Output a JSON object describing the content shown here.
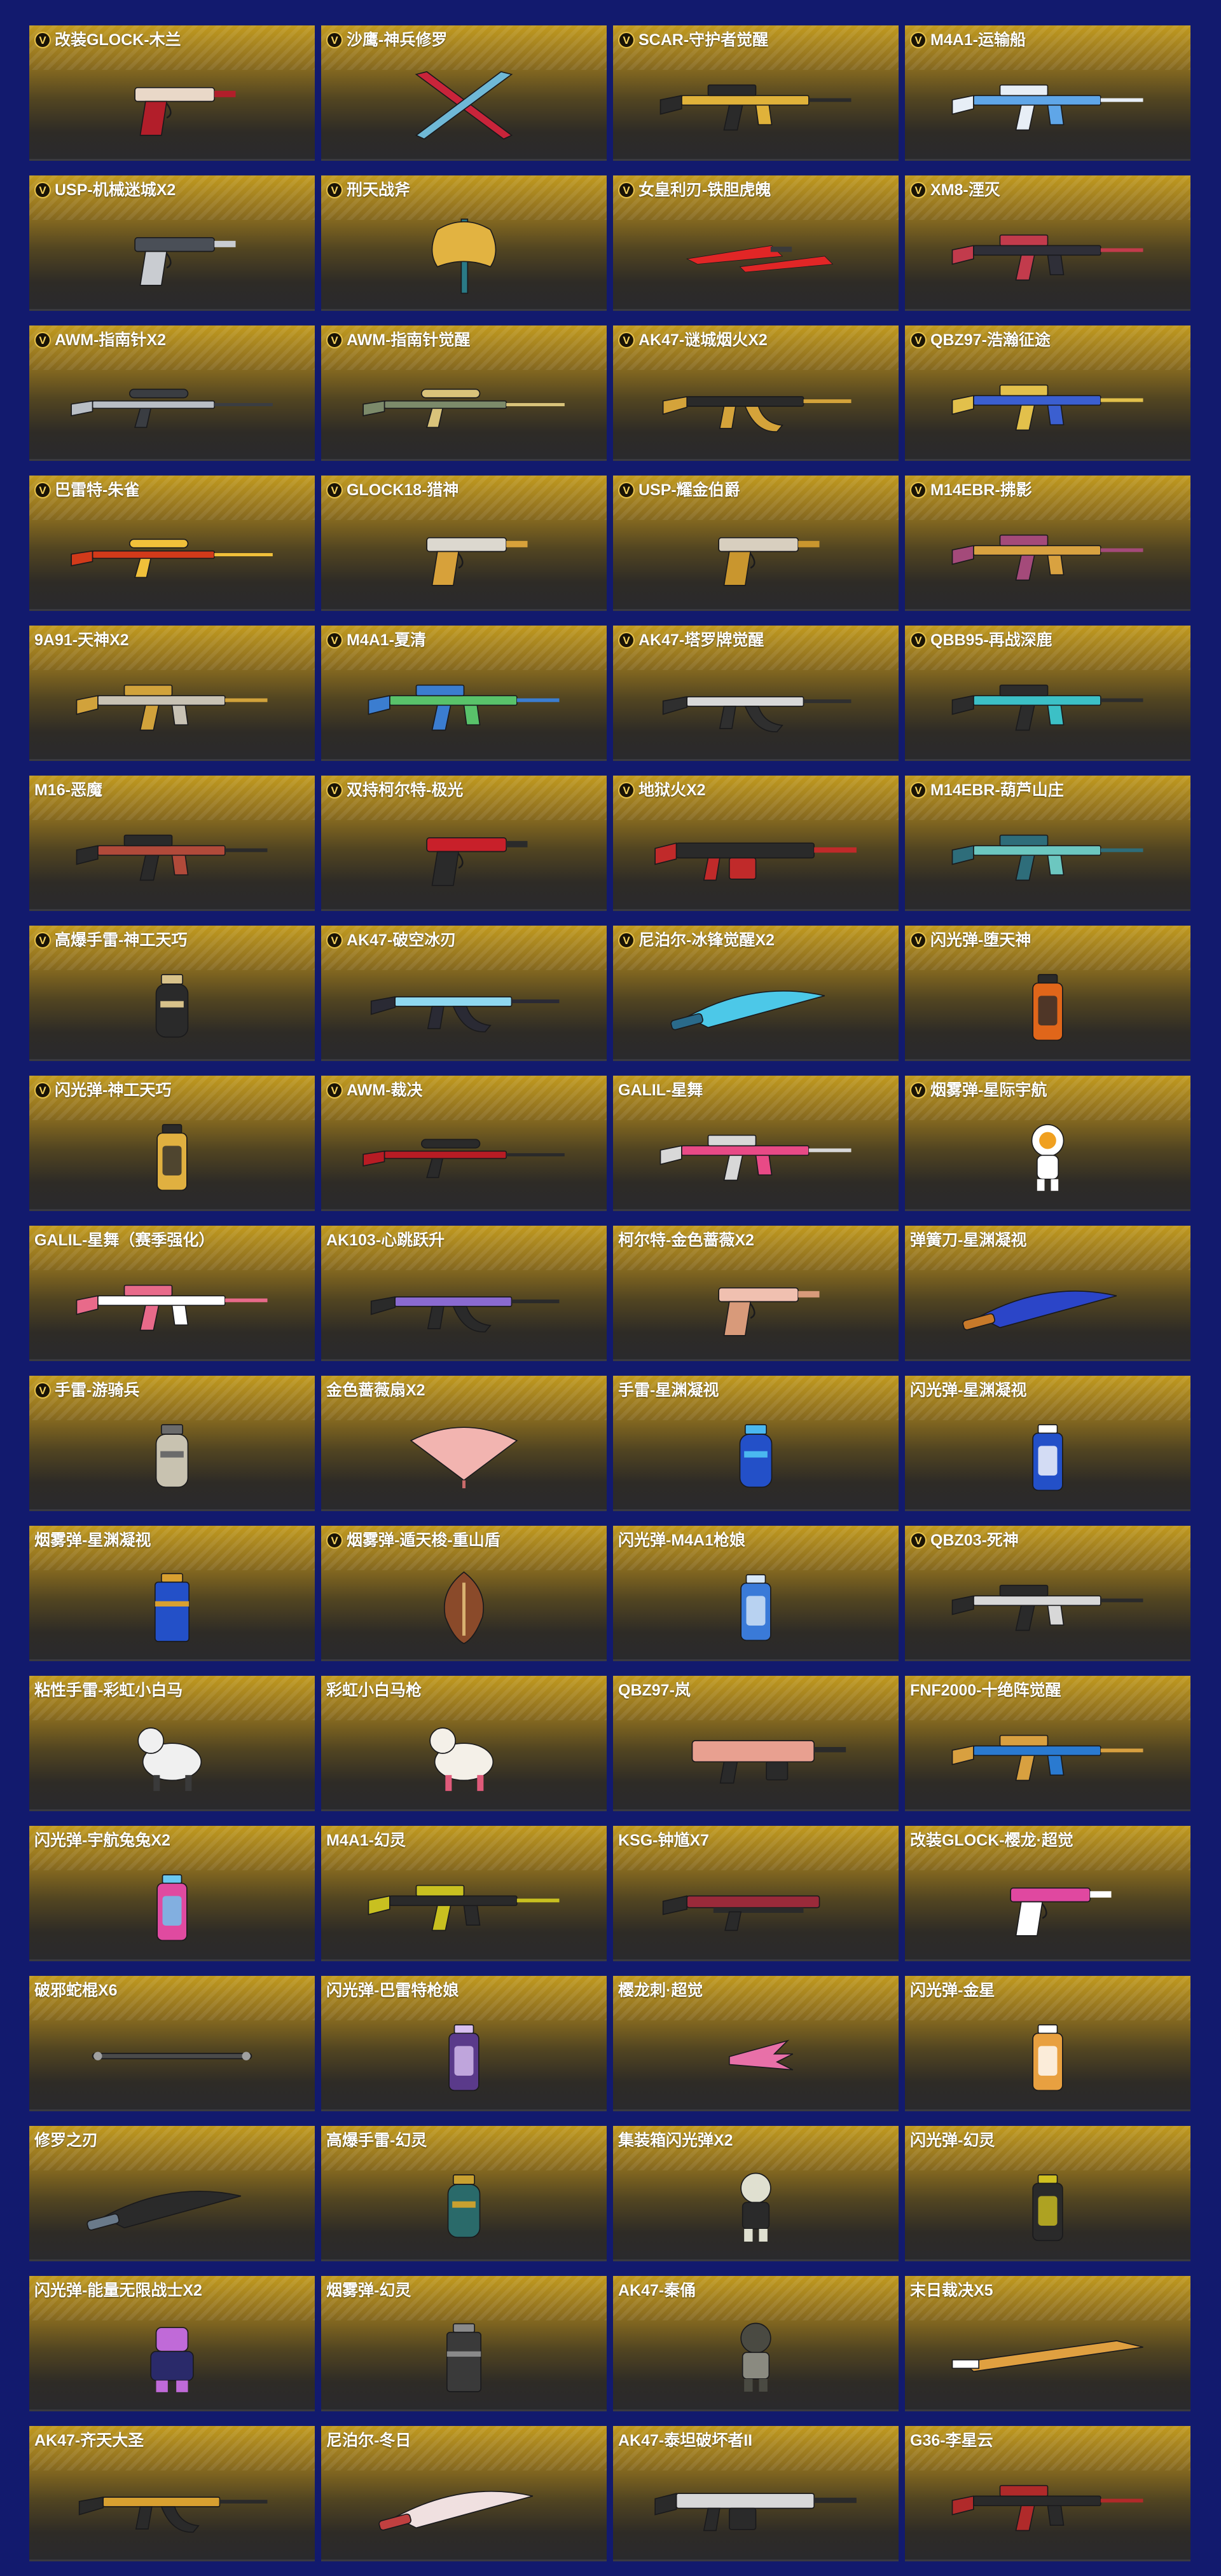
{
  "items": [
    {
      "name": "改装GLOCK-木兰",
      "badge": true,
      "icon": "pistol-icon",
      "colors": [
        "#e9d8c8",
        "#b21e2a"
      ]
    },
    {
      "name": "沙鹰-神兵修罗",
      "badge": true,
      "icon": "crossed-blades-icon",
      "colors": [
        "#c9243a",
        "#6fb8d6"
      ]
    },
    {
      "name": "SCAR-守护者觉醒",
      "badge": true,
      "icon": "rifle-icon",
      "colors": [
        "#e0b23a",
        "#2a2a2a"
      ]
    },
    {
      "name": "M4A1-运输船",
      "badge": true,
      "icon": "rifle-icon",
      "colors": [
        "#5fa6e8",
        "#e7eef6"
      ]
    },
    {
      "name": "USP-机械迷城X2",
      "badge": true,
      "icon": "pistol-icon",
      "colors": [
        "#4a4f57",
        "#c9ccd1"
      ]
    },
    {
      "name": "刑天战斧",
      "badge": true,
      "icon": "axe-icon",
      "colors": [
        "#e2b341",
        "#2a7a86"
      ]
    },
    {
      "name": "女皇利刃-铁胆虎魄",
      "badge": true,
      "icon": "twin-blade-icon",
      "colors": [
        "#e12626",
        "#3a3a3a"
      ]
    },
    {
      "name": "XM8-湮灭",
      "badge": true,
      "icon": "rifle-icon",
      "colors": [
        "#2f2f38",
        "#c23b4c"
      ]
    },
    {
      "name": "AWM-指南针X2",
      "badge": true,
      "icon": "sniper-icon",
      "colors": [
        "#b9bec5",
        "#3a3d42"
      ]
    },
    {
      "name": "AWM-指南针觉醒",
      "badge": true,
      "icon": "sniper-icon",
      "colors": [
        "#7c8a6a",
        "#d9c37a"
      ]
    },
    {
      "name": "AK47-谜城烟火X2",
      "badge": true,
      "icon": "ak-icon",
      "colors": [
        "#2a2a2a",
        "#d4a33a"
      ]
    },
    {
      "name": "QBZ97-浩瀚征途",
      "badge": true,
      "icon": "rifle-icon",
      "colors": [
        "#3b5fd0",
        "#e2c04b"
      ]
    },
    {
      "name": "巴雷特-朱雀",
      "badge": true,
      "icon": "sniper-icon",
      "colors": [
        "#d23a1a",
        "#f0c03a"
      ]
    },
    {
      "name": "GLOCK18-猎神",
      "badge": true,
      "icon": "pistol-icon",
      "colors": [
        "#dcd8cf",
        "#d7a13a"
      ]
    },
    {
      "name": "USP-耀金伯爵",
      "badge": true,
      "icon": "pistol-icon",
      "colors": [
        "#d8cfbf",
        "#c9962e"
      ]
    },
    {
      "name": "M14EBR-拂影",
      "badge": true,
      "icon": "rifle-icon",
      "colors": [
        "#d9a240",
        "#a44a7a"
      ]
    },
    {
      "name": "9A91-天神X2",
      "badge": false,
      "icon": "rifle-icon",
      "colors": [
        "#c8c2b4",
        "#d1a23b"
      ]
    },
    {
      "name": "M4A1-夏清",
      "badge": true,
      "icon": "rifle-icon",
      "colors": [
        "#59c26a",
        "#3b7dd0"
      ]
    },
    {
      "name": "AK47-塔罗牌觉醒",
      "badge": true,
      "icon": "ak-icon",
      "colors": [
        "#d8d8d8",
        "#2f2f2f"
      ]
    },
    {
      "name": "QBB95-再战深鹿",
      "badge": true,
      "icon": "rifle-icon",
      "colors": [
        "#3cc0c6",
        "#2c2c2c"
      ]
    },
    {
      "name": "M16-恶魔",
      "badge": false,
      "icon": "rifle-icon",
      "colors": [
        "#b14a3a",
        "#2a2a2a"
      ]
    },
    {
      "name": "双持柯尔特-极光",
      "badge": true,
      "icon": "pistol-icon",
      "colors": [
        "#c8202a",
        "#2a2a2a"
      ]
    },
    {
      "name": "地狱火X2",
      "badge": true,
      "icon": "lmg-icon",
      "colors": [
        "#2a2a2a",
        "#c02a2a"
      ]
    },
    {
      "name": "M14EBR-葫芦山庄",
      "badge": true,
      "icon": "rifle-icon",
      "colors": [
        "#6cc7c0",
        "#2e6d7a"
      ]
    },
    {
      "name": "高爆手雷-神工天巧",
      "badge": true,
      "icon": "grenade-icon",
      "colors": [
        "#2a2a2a",
        "#d8c28a"
      ]
    },
    {
      "name": "AK47-破空冰刃",
      "badge": true,
      "icon": "ak-icon",
      "colors": [
        "#8fd8f0",
        "#2a2a34"
      ]
    },
    {
      "name": "尼泊尔-冰锋觉醒X2",
      "badge": true,
      "icon": "knife-icon",
      "colors": [
        "#4cc8e8",
        "#2a6a8a"
      ]
    },
    {
      "name": "闪光弹-堕天神",
      "badge": true,
      "icon": "flashbang-icon",
      "colors": [
        "#e0661a",
        "#2a2a2a"
      ]
    },
    {
      "name": "闪光弹-神工天巧",
      "badge": true,
      "icon": "flashbang-icon",
      "colors": [
        "#e0b040",
        "#2a2a2a"
      ]
    },
    {
      "name": "AWM-裁决",
      "badge": true,
      "icon": "sniper-icon",
      "colors": [
        "#b81c24",
        "#2a2a2a"
      ]
    },
    {
      "name": "GALIL-星舞",
      "badge": false,
      "icon": "rifle-icon",
      "colors": [
        "#e84a86",
        "#d8d8d8"
      ]
    },
    {
      "name": "烟雾弹-星际宇航",
      "badge": true,
      "icon": "astronaut-icon",
      "colors": [
        "#ffffff",
        "#f0a020"
      ]
    },
    {
      "name": "GALIL-星舞（赛季强化）",
      "badge": false,
      "icon": "rifle-icon",
      "colors": [
        "#ffffff",
        "#e86a8a"
      ]
    },
    {
      "name": "AK103-心跳跃升",
      "badge": false,
      "icon": "ak-icon",
      "colors": [
        "#8a6ad0",
        "#2a2a2a"
      ]
    },
    {
      "name": "柯尔特-金色蔷薇X2",
      "badge": false,
      "icon": "pistol-icon",
      "colors": [
        "#f0c0b0",
        "#d89a7a"
      ]
    },
    {
      "name": "弹簧刀-星渊凝视",
      "badge": false,
      "icon": "knife-icon",
      "colors": [
        "#2b45c8",
        "#c87a2a"
      ]
    },
    {
      "name": "手雷-游骑兵",
      "badge": true,
      "icon": "grenade-icon",
      "colors": [
        "#c8c2b0",
        "#6b6b6b"
      ]
    },
    {
      "name": "金色蔷薇扇X2",
      "badge": false,
      "icon": "fan-icon",
      "colors": [
        "#f2b4b0",
        "#c86a6a"
      ]
    },
    {
      "name": "手雷-星渊凝视",
      "badge": false,
      "icon": "grenade-icon",
      "colors": [
        "#2350c8",
        "#4ab8f0"
      ]
    },
    {
      "name": "闪光弹-星渊凝视",
      "badge": false,
      "icon": "flashbang-icon",
      "colors": [
        "#2350c8",
        "#ffffff"
      ]
    },
    {
      "name": "烟雾弹-星渊凝视",
      "badge": false,
      "icon": "smoke-grenade-icon",
      "colors": [
        "#2350c8",
        "#d8a030"
      ]
    },
    {
      "name": "烟雾弹-遁天梭-重山盾",
      "badge": true,
      "icon": "shield-icon",
      "colors": [
        "#8a4a2a",
        "#d8b070"
      ]
    },
    {
      "name": "闪光弹-M4A1枪娘",
      "badge": false,
      "icon": "flashbang-icon",
      "colors": [
        "#3a7ad8",
        "#d8e8f8"
      ]
    },
    {
      "name": "QBZ03-死神",
      "badge": true,
      "icon": "rifle-icon",
      "colors": [
        "#d8d8d8",
        "#2a2a2a"
      ]
    },
    {
      "name": "粘性手雷-彩虹小白马",
      "badge": false,
      "icon": "horse-icon",
      "colors": [
        "#f0f0f0",
        "#3a3a3a"
      ]
    },
    {
      "name": "彩虹小白马枪",
      "badge": false,
      "icon": "horse-icon",
      "colors": [
        "#f4f0e8",
        "#e05a7a"
      ]
    },
    {
      "name": "QBZ97-岚",
      "badge": false,
      "icon": "smg-icon",
      "colors": [
        "#e8a090",
        "#2a2a2a"
      ]
    },
    {
      "name": "FNF2000-十绝阵觉醒",
      "badge": false,
      "icon": "rifle-icon",
      "colors": [
        "#2a7ad0",
        "#d8a040"
      ]
    },
    {
      "name": "闪光弹-宇航兔兔X2",
      "badge": false,
      "icon": "flashbang-icon",
      "colors": [
        "#e04aa0",
        "#6ac8f0"
      ]
    },
    {
      "name": "M4A1-幻灵",
      "badge": false,
      "icon": "rifle-icon",
      "colors": [
        "#2a2a2a",
        "#c8c020"
      ]
    },
    {
      "name": "KSG-钟馗X7",
      "badge": false,
      "icon": "shotgun-icon",
      "colors": [
        "#9a2a3a",
        "#2a2a2a"
      ]
    },
    {
      "name": "改装GLOCK-樱龙·超觉",
      "badge": false,
      "icon": "pistol-icon",
      "colors": [
        "#e048a0",
        "#ffffff"
      ]
    },
    {
      "name": "破邪蛇棍X6",
      "badge": false,
      "icon": "staff-icon",
      "colors": [
        "#4a4a4a",
        "#a0a0a0"
      ]
    },
    {
      "name": "闪光弹-巴雷特枪娘",
      "badge": false,
      "icon": "flashbang-icon",
      "colors": [
        "#5a3a8a",
        "#d8c0f0"
      ]
    },
    {
      "name": "樱龙刺·超觉",
      "badge": false,
      "icon": "claw-icon",
      "colors": [
        "#e870a8",
        "#ffffff"
      ]
    },
    {
      "name": "闪光弹-金星",
      "badge": false,
      "icon": "flashbang-icon",
      "colors": [
        "#e8a040",
        "#ffffff"
      ]
    },
    {
      "name": "修罗之刃",
      "badge": false,
      "icon": "knife-icon",
      "colors": [
        "#2a2a2a",
        "#6a7a8a"
      ]
    },
    {
      "name": "高爆手雷-幻灵",
      "badge": false,
      "icon": "grenade-icon",
      "colors": [
        "#2a6a6a",
        "#c8a030"
      ]
    },
    {
      "name": "集装箱闪光弹X2",
      "badge": false,
      "icon": "figure-icon",
      "colors": [
        "#e0e0d0",
        "#2a2a2a"
      ]
    },
    {
      "name": "闪光弹-幻灵",
      "badge": false,
      "icon": "flashbang-icon",
      "colors": [
        "#2a2a2a",
        "#d0c020"
      ]
    },
    {
      "name": "闪光弹-能量无限战士X2",
      "badge": false,
      "icon": "robot-icon",
      "colors": [
        "#c06ad8",
        "#2a2a6a"
      ]
    },
    {
      "name": "烟雾弹-幻灵",
      "badge": false,
      "icon": "smoke-grenade-icon",
      "colors": [
        "#3a3a3a",
        "#8a8a8a"
      ]
    },
    {
      "name": "AK47-秦俑",
      "badge": false,
      "icon": "figure-icon",
      "colors": [
        "#4a4a42",
        "#8a8a80"
      ]
    },
    {
      "name": "末日裁决X5",
      "badge": false,
      "icon": "greatsword-icon",
      "colors": [
        "#e0a040",
        "#ffffff"
      ]
    },
    {
      "name": "AK47-齐天大圣",
      "badge": false,
      "icon": "ak-icon",
      "colors": [
        "#d8a030",
        "#2a2a2a"
      ]
    },
    {
      "name": "尼泊尔-冬日",
      "badge": false,
      "icon": "knife-icon",
      "colors": [
        "#f0e0e0",
        "#c04040"
      ]
    },
    {
      "name": "AK47-泰坦破坏者II",
      "badge": false,
      "icon": "lmg-icon",
      "colors": [
        "#d8d8d8",
        "#2a2a2a"
      ]
    },
    {
      "name": "G36-李星云",
      "badge": false,
      "icon": "rifle-icon",
      "colors": [
        "#2a2a2a",
        "#b02a2a"
      ]
    }
  ]
}
